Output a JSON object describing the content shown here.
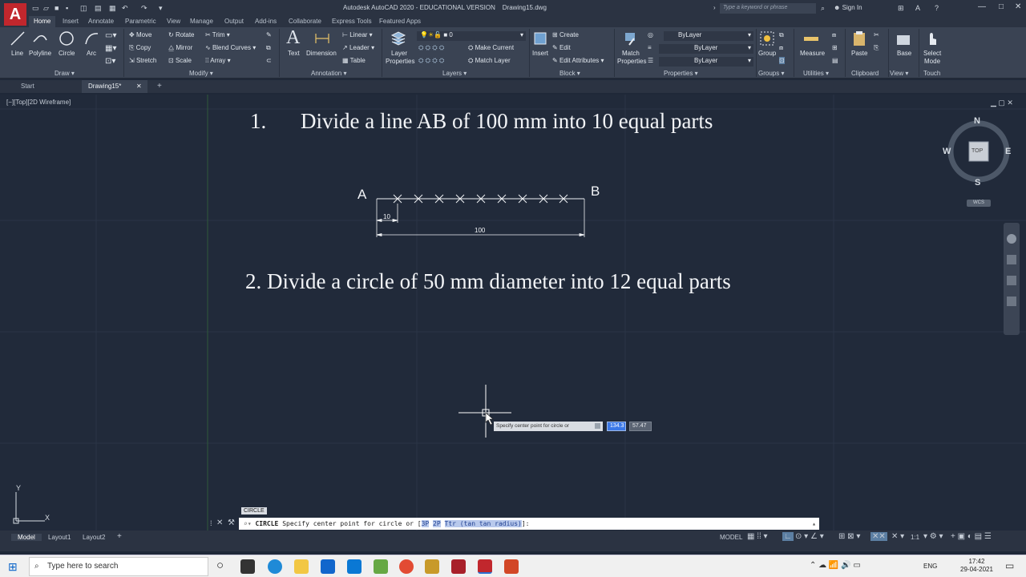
{
  "window": {
    "title": "Autodesk AutoCAD 2020 - EDUCATIONAL VERSION",
    "filename": "Drawing15.dwg",
    "search_placeholder": "Type a keyword or phrase",
    "sign_in": "Sign In",
    "logo": "A"
  },
  "ribbon_tabs": [
    "Home",
    "Insert",
    "Annotate",
    "Parametric",
    "View",
    "Manage",
    "Output",
    "Add-ins",
    "Collaborate",
    "Express Tools",
    "Featured Apps"
  ],
  "ribbon": {
    "draw": {
      "line": "Line",
      "polyline": "Polyline",
      "circle": "Circle",
      "arc": "Arc",
      "title": "Draw ▾"
    },
    "modify": {
      "move": "Move",
      "rotate": "Rotate",
      "trim": "Trim",
      "copy": "Copy",
      "mirror": "Mirror",
      "blend": "Blend Curves",
      "stretch": "Stretch",
      "scale": "Scale",
      "array": "Array",
      "title": "Modify ▾"
    },
    "annotation": {
      "text": "Text",
      "dimension": "Dimension",
      "linear": "Linear",
      "leader": "Leader",
      "table": "Table",
      "title": "Annotation ▾"
    },
    "layers": {
      "props_1": "Layer",
      "props_2": "Properties",
      "layer_value": "0",
      "make_current": "Make Current",
      "match_layer": "Match Layer",
      "title": "Layers ▾"
    },
    "block": {
      "insert": "Insert",
      "create": "Create",
      "edit": "Edit",
      "edit_attr": "Edit Attributes",
      "title": "Block ▾"
    },
    "properties": {
      "match_1": "Match",
      "match_2": "Properties",
      "color": "ByLayer",
      "linetype": "ByLayer",
      "lineweight": "ByLayer",
      "title": "Properties ▾"
    },
    "groups": {
      "group": "Group",
      "title": "Groups ▾"
    },
    "utilities": {
      "measure": "Measure",
      "title": "Utilities ▾"
    },
    "clipboard": {
      "paste": "Paste",
      "title": "Clipboard"
    },
    "view": {
      "base": "Base",
      "title": "View ▾"
    },
    "touch": {
      "select_1": "Select",
      "select_2": "Mode",
      "title": "Touch"
    }
  },
  "doc_tabs": [
    "Start",
    "Drawing15*"
  ],
  "viewport_label": "[−][Top][2D Wireframe]",
  "drawing": {
    "heading1_num": "1.",
    "heading1": "Divide a line AB of 100 mm into 10 equal parts",
    "point_a": "A",
    "point_b": "B",
    "dim_small": "10",
    "dim_total": "100",
    "heading2": "2. Divide a circle of 50 mm diameter into 12 equal parts"
  },
  "viewcube": {
    "n": "N",
    "s": "S",
    "e": "E",
    "w": "W",
    "top": "TOP",
    "wcs": "WCS"
  },
  "ucs": {
    "x": "X",
    "y": "Y"
  },
  "tooltip": {
    "prompt": "Specify center point for circle or",
    "x_value": "134.3",
    "y_value": "57.47"
  },
  "command": {
    "tag": "CIRCLE",
    "name": "CIRCLE",
    "prompt": "Specify center point for circle or [",
    "opt_3p": "3P",
    "opt_2p": "2P",
    "opt_ttr": "Ttr (tan tan radius)",
    "end": "]:"
  },
  "layout_tabs": [
    "Model",
    "Layout1",
    "Layout2"
  ],
  "status": {
    "model": "MODEL",
    "scale": "1:1"
  },
  "taskbar": {
    "search": "Type here to search",
    "lang": "ENG",
    "time": "17:42",
    "date": "29-04-2021"
  },
  "colors": {
    "canvas": "#212a3a",
    "ribbon": "#3a4353",
    "accent_red": "#c1272d",
    "highlight_blue": "#3b78e7"
  }
}
